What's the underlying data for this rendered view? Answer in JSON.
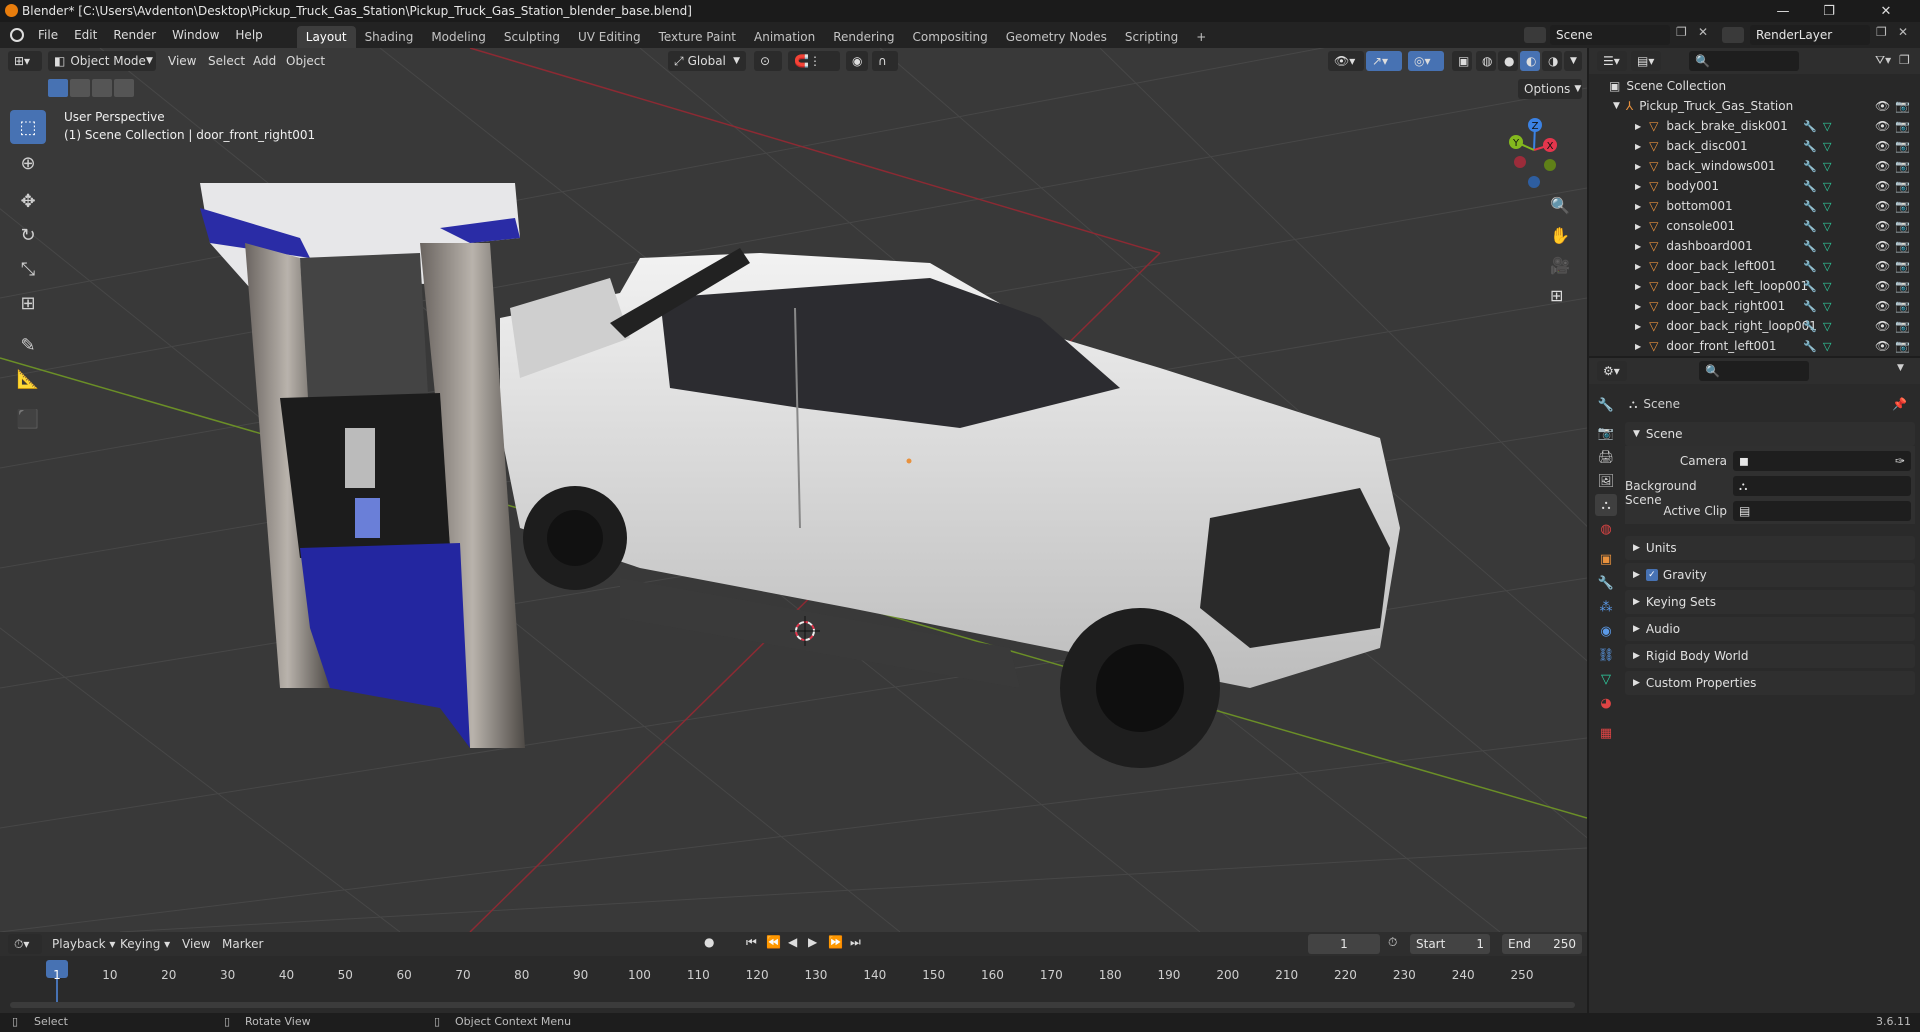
{
  "window": {
    "title": "Blender* [C:\\Users\\Avdenton\\Desktop\\Pickup_Truck_Gas_Station\\Pickup_Truck_Gas_Station_blender_base.blend]",
    "minimize": "—",
    "maximize": "❐",
    "close": "✕"
  },
  "menu": [
    "File",
    "Edit",
    "Render",
    "Window",
    "Help"
  ],
  "workspaces": [
    "Layout",
    "Shading",
    "Modeling",
    "Sculpting",
    "UV Editing",
    "Texture Paint",
    "Animation",
    "Rendering",
    "Compositing",
    "Geometry Nodes",
    "Scripting"
  ],
  "workspace_add": "+",
  "scene_name": "Scene",
  "view_layer": "RenderLayer",
  "viewport": {
    "mode": "Object Mode",
    "menus": [
      "View",
      "Select",
      "Add",
      "Object"
    ],
    "transform_orientation": "Global",
    "options_label": "Options",
    "perspective_label": "User Perspective",
    "collection_label": "(1) Scene Collection | door_front_right001",
    "gizmo_axes": {
      "z": "Z",
      "y": "Y",
      "x": "X"
    }
  },
  "outliner": {
    "root": "Scene Collection",
    "collection": "Pickup_Truck_Gas_Station",
    "objects": [
      "back_brake_disk001",
      "back_disc001",
      "back_windows001",
      "body001",
      "bottom001",
      "console001",
      "dashboard001",
      "door_back_left001",
      "door_back_left_loop001",
      "door_back_right001",
      "door_back_right_loop001",
      "door_front_left001"
    ]
  },
  "properties": {
    "header": "Scene",
    "section": "Scene",
    "fields": [
      {
        "label": "Camera",
        "value": ""
      },
      {
        "label": "Background Scene",
        "value": ""
      },
      {
        "label": "Active Clip",
        "value": ""
      }
    ],
    "panels": [
      "Units",
      "Gravity",
      "Keying Sets",
      "Audio",
      "Rigid Body World",
      "Custom Properties"
    ]
  },
  "timeline": {
    "menus": [
      "Playback",
      "Keying",
      "View",
      "Marker"
    ],
    "current_frame": "1",
    "start_label": "Start",
    "start": "1",
    "end_label": "End",
    "end": "250",
    "ticks": [
      "1",
      "10",
      "20",
      "30",
      "40",
      "50",
      "60",
      "70",
      "80",
      "90",
      "100",
      "110",
      "120",
      "130",
      "140",
      "150",
      "160",
      "170",
      "180",
      "190",
      "200",
      "210",
      "220",
      "230",
      "240",
      "250"
    ]
  },
  "status": {
    "select": "Select",
    "rotate": "Rotate View",
    "context": "Object Context Menu",
    "version": "3.6.11"
  },
  "colors": {
    "accent": "#4772b3",
    "object_icon": "#e8913d",
    "mesh_icon": "#2fd1a1",
    "x_axis": "#e3364d",
    "y_axis": "#84b91e",
    "z_axis": "#3b82e4"
  }
}
